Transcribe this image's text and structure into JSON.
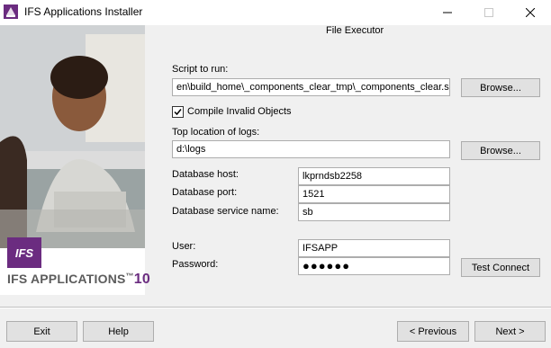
{
  "window": {
    "title": "IFS Applications Installer",
    "minimize_icon": "minimize-icon",
    "maximize_icon": "maximize-icon",
    "close_icon": "close-icon"
  },
  "section_title": "File Executor",
  "branding": {
    "badge": "IFS",
    "product": "IFS APPLICATIONS",
    "tm": "™",
    "version": "10",
    "brand_color": "#6b2c80"
  },
  "form": {
    "script_label": "Script to run:",
    "script_value": "en\\build_home\\_components_clear_tmp\\_components_clear.sql",
    "browse_label": "Browse...",
    "compile_label": "Compile Invalid Objects",
    "compile_checked": true,
    "logs_label": "Top location of logs:",
    "logs_value": "d:\\logs",
    "db_host_label": "Database host:",
    "db_host_value": "lkprndsb2258",
    "db_port_label": "Database port:",
    "db_port_value": "1521",
    "db_service_label": "Database service name:",
    "db_service_value": "sb",
    "user_label": "User:",
    "user_value": "IFSAPP",
    "password_label": "Password:",
    "password_value": "●●●●●●",
    "test_connect_label": "Test Connect"
  },
  "footer": {
    "exit_label": "Exit",
    "help_label": "Help",
    "previous_label": "< Previous",
    "next_label": "Next >"
  }
}
